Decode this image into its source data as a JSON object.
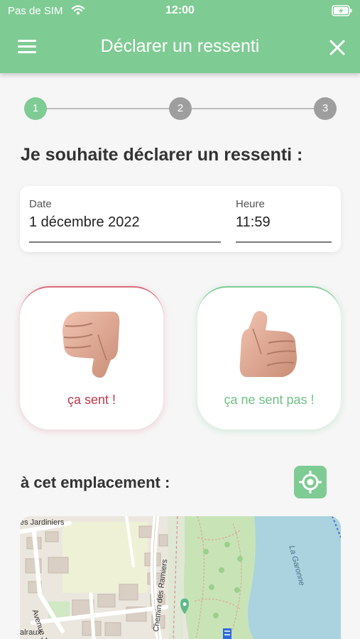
{
  "status_bar": {
    "carrier": "Pas de SIM",
    "time": "12:00",
    "wifi_icon": "wifi-icon",
    "battery_icon": "battery-charging-icon"
  },
  "app_bar": {
    "title": "Déclarer un ressenti",
    "menu_icon": "menu-icon",
    "close_icon": "close-icon"
  },
  "stepper": {
    "steps": [
      "1",
      "2",
      "3"
    ],
    "current_step": 1
  },
  "heading": "Je souhaite déclarer un ressenti :",
  "date_field": {
    "label": "Date",
    "value": "1 décembre 2022"
  },
  "time_field": {
    "label": "Heure",
    "value": "11:59"
  },
  "choices": {
    "smells": {
      "label": "ça sent !",
      "icon": "thumbs-down-icon",
      "color": "#c0394a"
    },
    "no_smell": {
      "label": "ça ne sent pas !",
      "icon": "thumbs-up-icon",
      "color": "#6fbf86"
    }
  },
  "location": {
    "label": "à cet emplacement :",
    "locate_icon": "crosshair-icon"
  },
  "map": {
    "labels": {
      "street_1": "es Jardiniers",
      "street_2": "Avenue Jules",
      "street_3": "Chemin des Ramiers",
      "street_4": "alraux",
      "river": "La Garonne"
    }
  },
  "colors": {
    "accent": "#7fcb94",
    "negative": "#c0394a",
    "inactive_step": "#9e9e9e"
  }
}
